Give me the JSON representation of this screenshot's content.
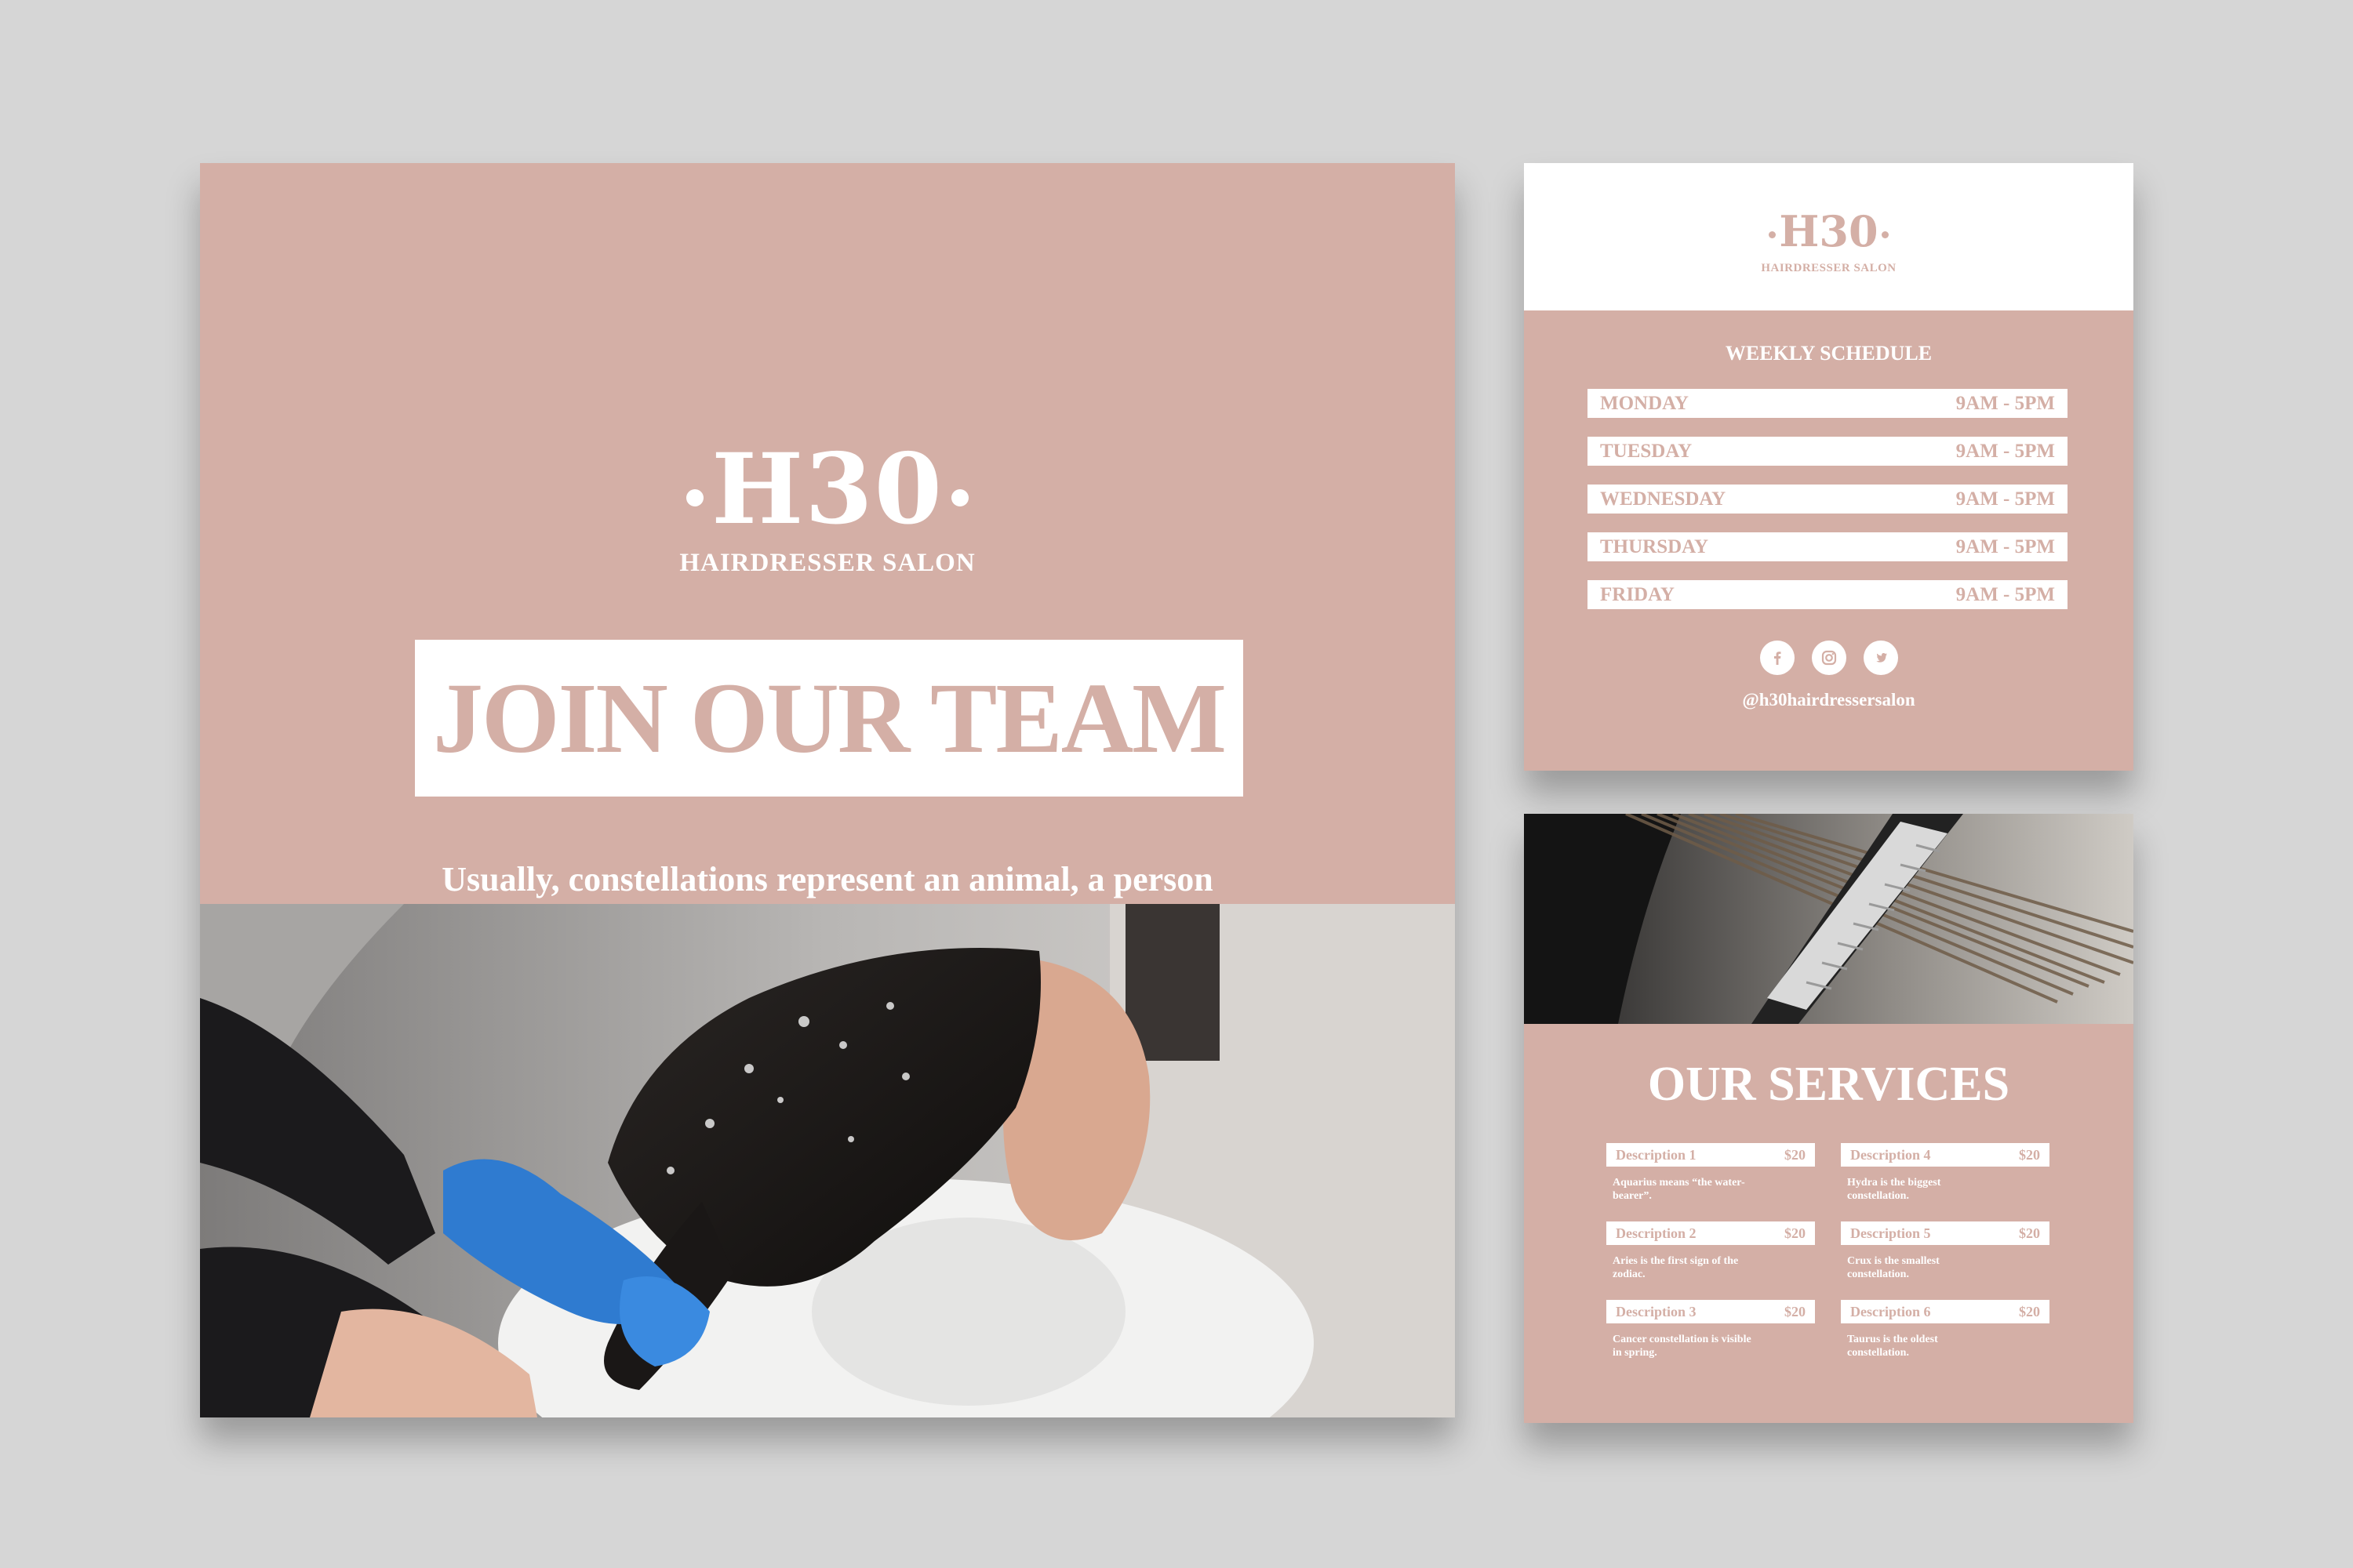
{
  "brand": {
    "logo": "H30",
    "subtitle": "HAIRDRESSER SALON"
  },
  "poster": {
    "headline": "JOIN OUR TEAM",
    "description": "Usually, constellations represent an animal, a person or mythological creature, or an inanimate object."
  },
  "schedule": {
    "title": "WEEKLY SCHEDULE",
    "rows": [
      {
        "day": "MONDAY",
        "hours": "9AM - 5PM"
      },
      {
        "day": "TUESDAY",
        "hours": "9AM - 5PM"
      },
      {
        "day": "WEDNESDAY",
        "hours": "9AM - 5PM"
      },
      {
        "day": "THURSDAY",
        "hours": "9AM - 5PM"
      },
      {
        "day": "FRIDAY",
        "hours": "9AM - 5PM"
      }
    ],
    "social_icons": [
      "facebook-icon",
      "instagram-icon",
      "twitter-icon"
    ],
    "handle": "@h30hairdressersalon"
  },
  "services": {
    "title": "OUR SERVICES",
    "items": [
      {
        "name": "Description 1",
        "price": "$20",
        "text": "Aquarius means “the water-bearer”."
      },
      {
        "name": "Description 2",
        "price": "$20",
        "text": "Aries is the first sign of the zodiac."
      },
      {
        "name": "Description 3",
        "price": "$20",
        "text": "Cancer constellation is visible in spring."
      },
      {
        "name": "Description 4",
        "price": "$20",
        "text": "Hydra is the biggest constellation."
      },
      {
        "name": "Description 5",
        "price": "$20",
        "text": "Crux is the smallest constellation."
      },
      {
        "name": "Description 6",
        "price": "$20",
        "text": "Taurus is the oldest constellation."
      }
    ]
  },
  "colors": {
    "background": "#d6d6d6",
    "accent_pink": "#d4afa6",
    "white": "#ffffff"
  }
}
